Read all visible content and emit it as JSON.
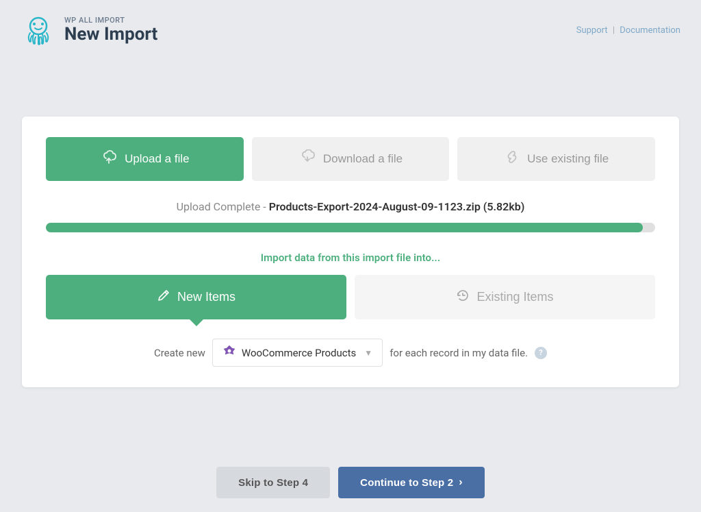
{
  "header": {
    "app_name": "WP ALL IMPORT",
    "page_title": "New Import",
    "support_label": "Support",
    "docs_label": "Documentation"
  },
  "tabs": [
    {
      "id": "upload",
      "label": "Upload a file",
      "icon": "upload-cloud",
      "state": "active"
    },
    {
      "id": "download",
      "label": "Download a file",
      "icon": "download-cloud",
      "state": "inactive"
    },
    {
      "id": "existing",
      "label": "Use existing file",
      "icon": "link",
      "state": "inactive"
    }
  ],
  "upload_status": {
    "prefix": "Upload Complete - ",
    "filename": "Products-Export-2024-August-09-1123.zip (5.82kb)"
  },
  "progress": {
    "percent": 98
  },
  "import_section": {
    "label": "Import data from this import file into...",
    "types": [
      {
        "id": "new",
        "label": "New Items",
        "icon": "pencil",
        "state": "active"
      },
      {
        "id": "existing",
        "label": "Existing Items",
        "icon": "history",
        "state": "inactive"
      }
    ]
  },
  "create_row": {
    "prefix": "Create new",
    "product_name": "WooCommerce Products",
    "suffix": "for each record in my data file.",
    "help_tooltip": "?"
  },
  "footer": {
    "skip_label": "Skip to Step 4",
    "continue_label": "Continue to Step 2"
  }
}
